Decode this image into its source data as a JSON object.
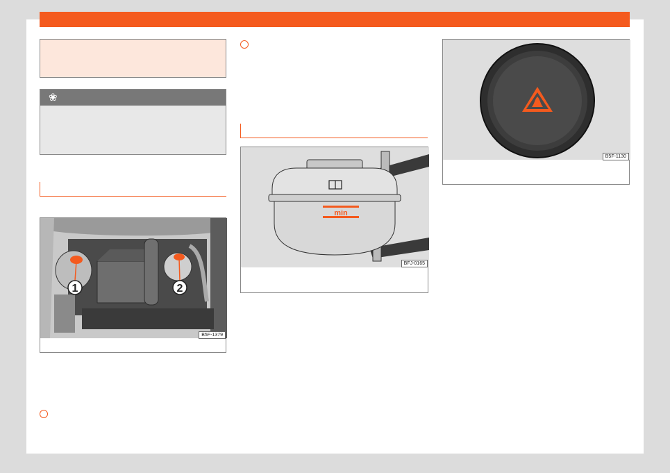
{
  "colors": {
    "accent": "#f45a1e",
    "note_bg": "#fde7dc",
    "env_header": "#787878",
    "env_bg": "#e8e8e8"
  },
  "environment_box": {
    "icon": "flower-icon",
    "glyph": "❀"
  },
  "figures": {
    "engine_bay": {
      "code": "B5F-1379",
      "callouts": [
        "1",
        "2"
      ]
    },
    "coolant_tank": {
      "code": "BFJ-0165",
      "mark_label": "min"
    },
    "coolant_cap": {
      "code": "B5F-1130"
    }
  },
  "markers": [
    "list-marker",
    "list-marker",
    "list-marker"
  ]
}
